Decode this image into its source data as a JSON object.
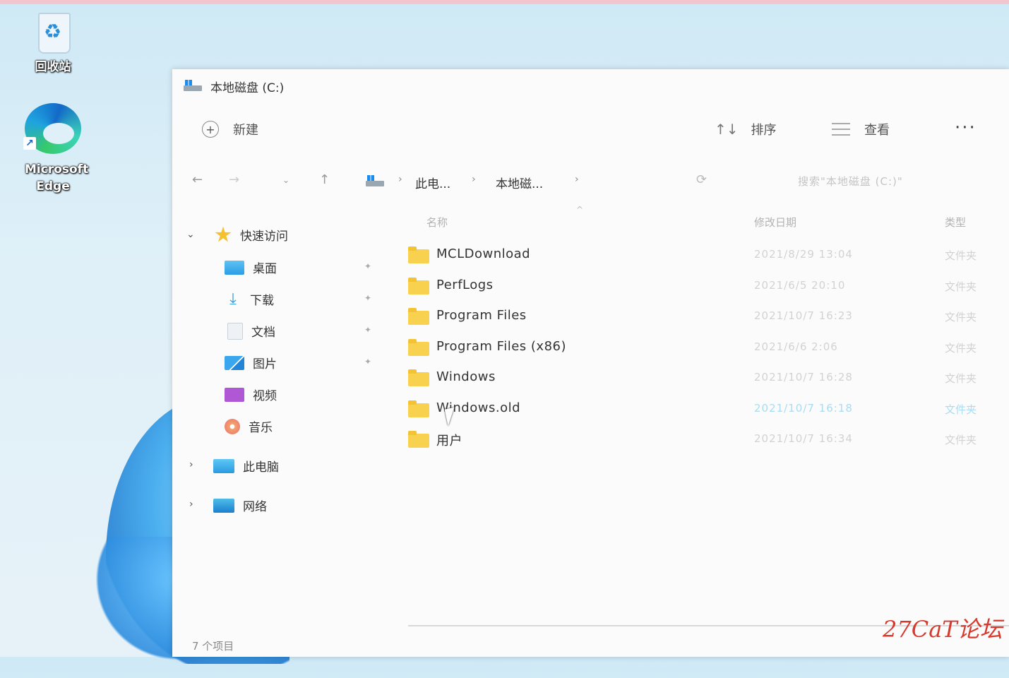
{
  "desktop": {
    "icons": [
      {
        "label": "回收站",
        "icon": "recycle-bin-icon"
      },
      {
        "label": "Microsoft Edge",
        "icon": "edge-icon"
      }
    ],
    "watermark": "27CaT论坛"
  },
  "window": {
    "title": "本地磁盘 (C:)",
    "toolbar": {
      "new_label": "新建",
      "sort_label": "排序",
      "view_label": "查看",
      "more_label": "···"
    },
    "nav": {
      "breadcrumb": [
        "此电...",
        "本地磁..."
      ],
      "search_placeholder": "搜索\"本地磁盘 (C:)\""
    },
    "sidebar": {
      "quick_access": "快速访问",
      "items": [
        {
          "label": "桌面",
          "icon": "desktop-icon",
          "pinned": true
        },
        {
          "label": "下载",
          "icon": "download-icon",
          "pinned": true
        },
        {
          "label": "文档",
          "icon": "document-icon",
          "pinned": true
        },
        {
          "label": "图片",
          "icon": "pictures-icon",
          "pinned": true
        },
        {
          "label": "视频",
          "icon": "videos-icon",
          "pinned": false
        },
        {
          "label": "音乐",
          "icon": "music-icon",
          "pinned": false
        }
      ],
      "this_pc": "此电脑",
      "network": "网络"
    },
    "columns": {
      "name": "名称",
      "date": "修改日期",
      "type": "类型"
    },
    "files": [
      {
        "name": "MCLDownload",
        "date": "2021/8/29 13:04",
        "type": "文件夹"
      },
      {
        "name": "PerfLogs",
        "date": "2021/6/5 20:10",
        "type": "文件夹"
      },
      {
        "name": "Program Files",
        "date": "2021/10/7 16:23",
        "type": "文件夹"
      },
      {
        "name": "Program Files (x86)",
        "date": "2021/6/6 2:06",
        "type": "文件夹"
      },
      {
        "name": "Windows",
        "date": "2021/10/7 16:28",
        "type": "文件夹"
      },
      {
        "name": "Windows.old",
        "date": "2021/10/7 16:18",
        "type": "文件夹"
      },
      {
        "name": "用户",
        "date": "2021/10/7 16:34",
        "type": "文件夹"
      }
    ],
    "status": "7 个项目"
  }
}
